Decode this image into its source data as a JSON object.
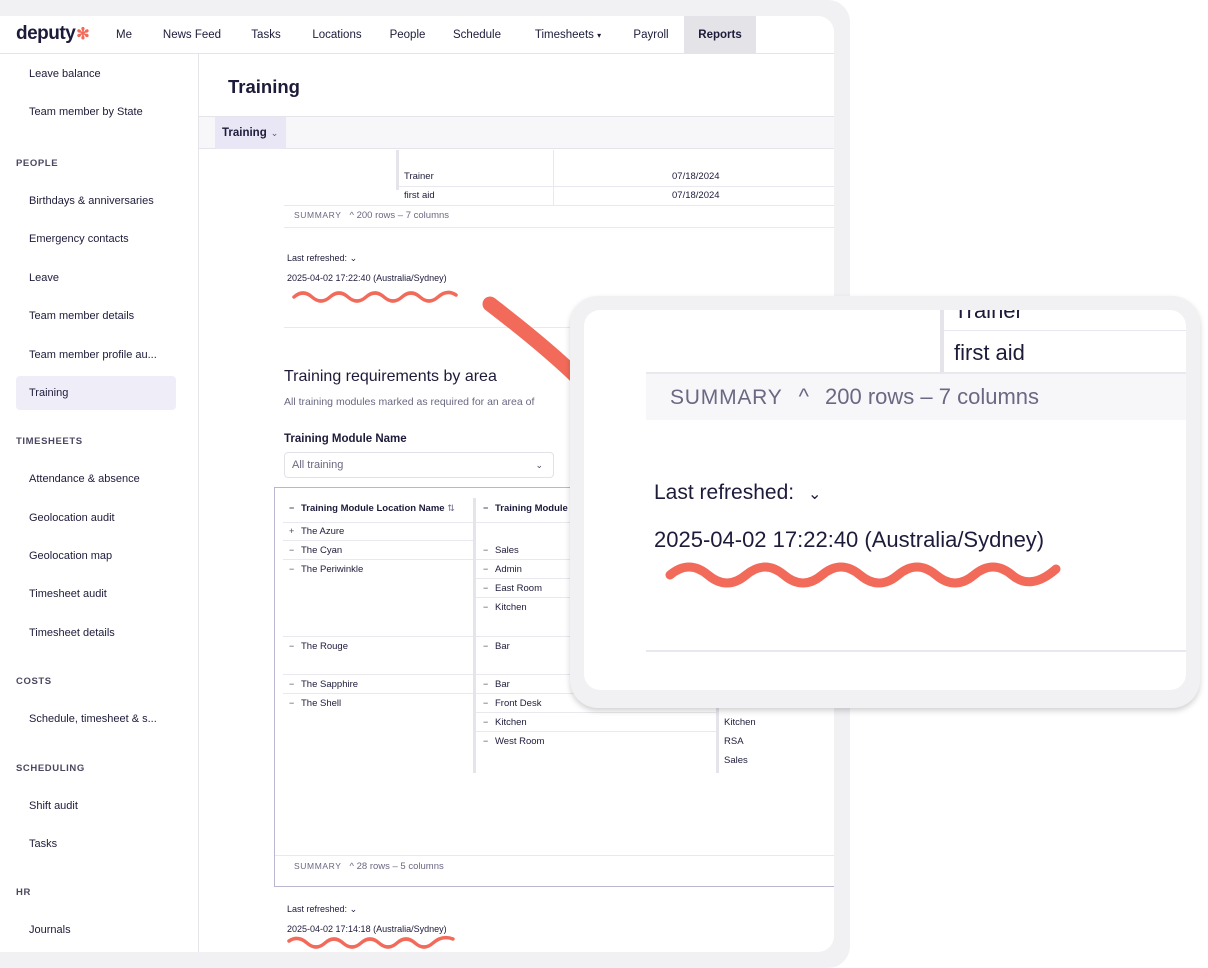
{
  "brand": {
    "name": "deputy",
    "mark": "✻"
  },
  "nav": {
    "me": "Me",
    "news_feed": "News Feed",
    "tasks": "Tasks",
    "locations": "Locations",
    "people": "People",
    "schedule": "Schedule",
    "timesheets": "Timesheets",
    "timesheets_caret": "▾",
    "payroll": "Payroll",
    "reports": "Reports"
  },
  "sidebar": {
    "leave_balance": "Leave balance",
    "team_member_by_state": "Team member by State",
    "people_heading": "PEOPLE",
    "birthdays": "Birthdays & anniversaries",
    "emergency": "Emergency contacts",
    "leave": "Leave",
    "team_member_details": "Team member details",
    "team_member_profile": "Team member profile au...",
    "training": "Training",
    "timesheets_heading": "TIMESHEETS",
    "attendance": "Attendance & absence",
    "geolocation_audit": "Geolocation audit",
    "geolocation_map": "Geolocation map",
    "timesheet_audit": "Timesheet audit",
    "timesheet_details": "Timesheet details",
    "costs_heading": "COSTS",
    "schedule_costs": "Schedule, timesheet & s...",
    "scheduling_heading": "SCHEDULING",
    "shift_audit": "Shift audit",
    "tasks": "Tasks",
    "hr_heading": "HR",
    "journals": "Journals"
  },
  "page": {
    "title": "Training",
    "tab_label": "Training",
    "tab_chevron": "⌄"
  },
  "top_table": {
    "rows": [
      {
        "name": "Trainer",
        "date": "07/18/2024"
      },
      {
        "name": "first aid",
        "date": "07/18/2024"
      }
    ],
    "summary_label": "SUMMARY",
    "summary_caret": "^",
    "summary_text": "200 rows – 7 columns",
    "refresh_label": "Last refreshed:",
    "refresh_chevron": "⌄",
    "refresh_value": "2025-04-02 17:22:40 (Australia/Sydney)"
  },
  "requirements": {
    "title": "Training requirements by area",
    "subtitle": "All training modules marked as required for an area of",
    "filter_label": "Training Module Name",
    "filter_value": "All training",
    "filter_chevron": "⌄",
    "col1_header": "Training Module Location Name",
    "col1_sort": "⇅",
    "col2_header": "Training Module",
    "locations": [
      {
        "toggle": "+",
        "name": "The Azure"
      },
      {
        "toggle": "−",
        "name": "The Cyan"
      },
      {
        "toggle": "−",
        "name": "The Periwinkle"
      },
      {
        "toggle": "−",
        "name": "The Rouge"
      },
      {
        "toggle": "−",
        "name": "The Sapphire"
      },
      {
        "toggle": "−",
        "name": "The Shell"
      }
    ],
    "areas": [
      {
        "toggle": "−",
        "name": "Sales"
      },
      {
        "toggle": "−",
        "name": "Admin"
      },
      {
        "toggle": "−",
        "name": "East Room"
      },
      {
        "toggle": "−",
        "name": "Kitchen"
      },
      {
        "toggle": "−",
        "name": "Bar"
      },
      {
        "toggle": "−",
        "name": "Bar"
      },
      {
        "toggle": "−",
        "name": "Front Desk"
      },
      {
        "toggle": "−",
        "name": "Kitchen"
      },
      {
        "toggle": "−",
        "name": "West Room"
      }
    ],
    "modules": [
      "Kitchen",
      "RSA",
      "Sales"
    ],
    "summary_label": "SUMMARY",
    "summary_caret": "^",
    "summary_text": "28 rows – 5 columns",
    "refresh_label": "Last refreshed:",
    "refresh_chevron": "⌄",
    "refresh_value": "2025-04-02 17:14:18 (Australia/Sydney)"
  },
  "zoom": {
    "row1": "Trainer",
    "row2": "first aid",
    "summary_label": "SUMMARY",
    "summary_caret": "^",
    "summary_text": "200 rows – 7 columns",
    "refresh_label": "Last refreshed:",
    "refresh_chevron": "⌄",
    "refresh_value": "2025-04-02 17:22:40 (Australia/Sydney)"
  },
  "colors": {
    "accent": "#f26a5a",
    "active_bg": "#efedf8",
    "text": "#1d1b3a"
  }
}
